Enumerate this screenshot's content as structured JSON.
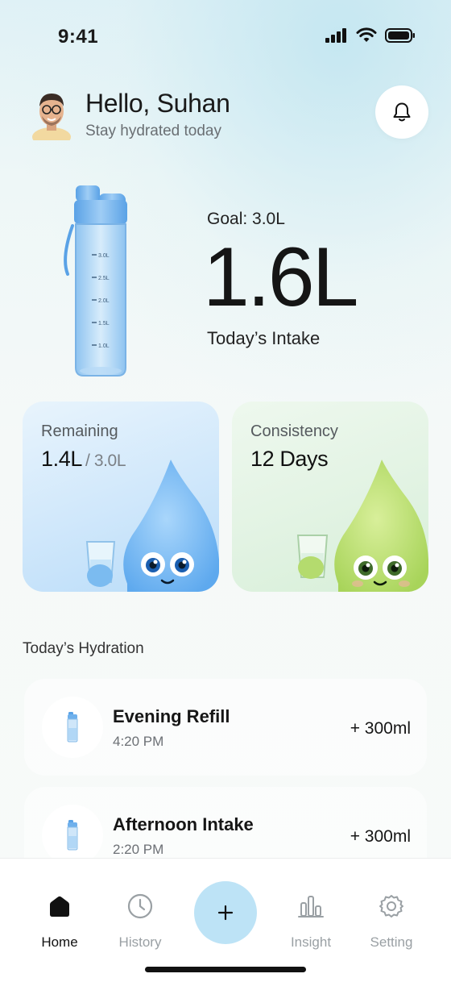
{
  "status": {
    "time": "9:41"
  },
  "header": {
    "greeting": "Hello, Suhan",
    "subtitle": "Stay hydrated today"
  },
  "hero": {
    "goal_label": "Goal: 3.0L",
    "intake_value": "1.6L",
    "intake_label": "Today’s Intake",
    "bottle_marks": [
      "3.0L",
      "2.5L",
      "2.0L",
      "1.5L",
      "1.0L"
    ]
  },
  "cards": {
    "remaining": {
      "label": "Remaining",
      "value": "1.4L",
      "total": "/ 3.0L"
    },
    "consistency": {
      "label": "Consistency",
      "value": "12 Days"
    }
  },
  "hydration": {
    "title": "Today’s Hydration",
    "items": [
      {
        "title": "Evening Refill",
        "time": "4:20 PM",
        "amount": "+ 300ml"
      },
      {
        "title": "Afternoon Intake",
        "time": "2:20 PM",
        "amount": "+ 300ml"
      }
    ]
  },
  "tabs": {
    "home": "Home",
    "history": "History",
    "add": "+",
    "insight": "Insight",
    "setting": "Setting"
  },
  "colors": {
    "accent": "#bde3f6",
    "card_blue": "#cfe7fb",
    "card_green": "#e2f3e3"
  }
}
